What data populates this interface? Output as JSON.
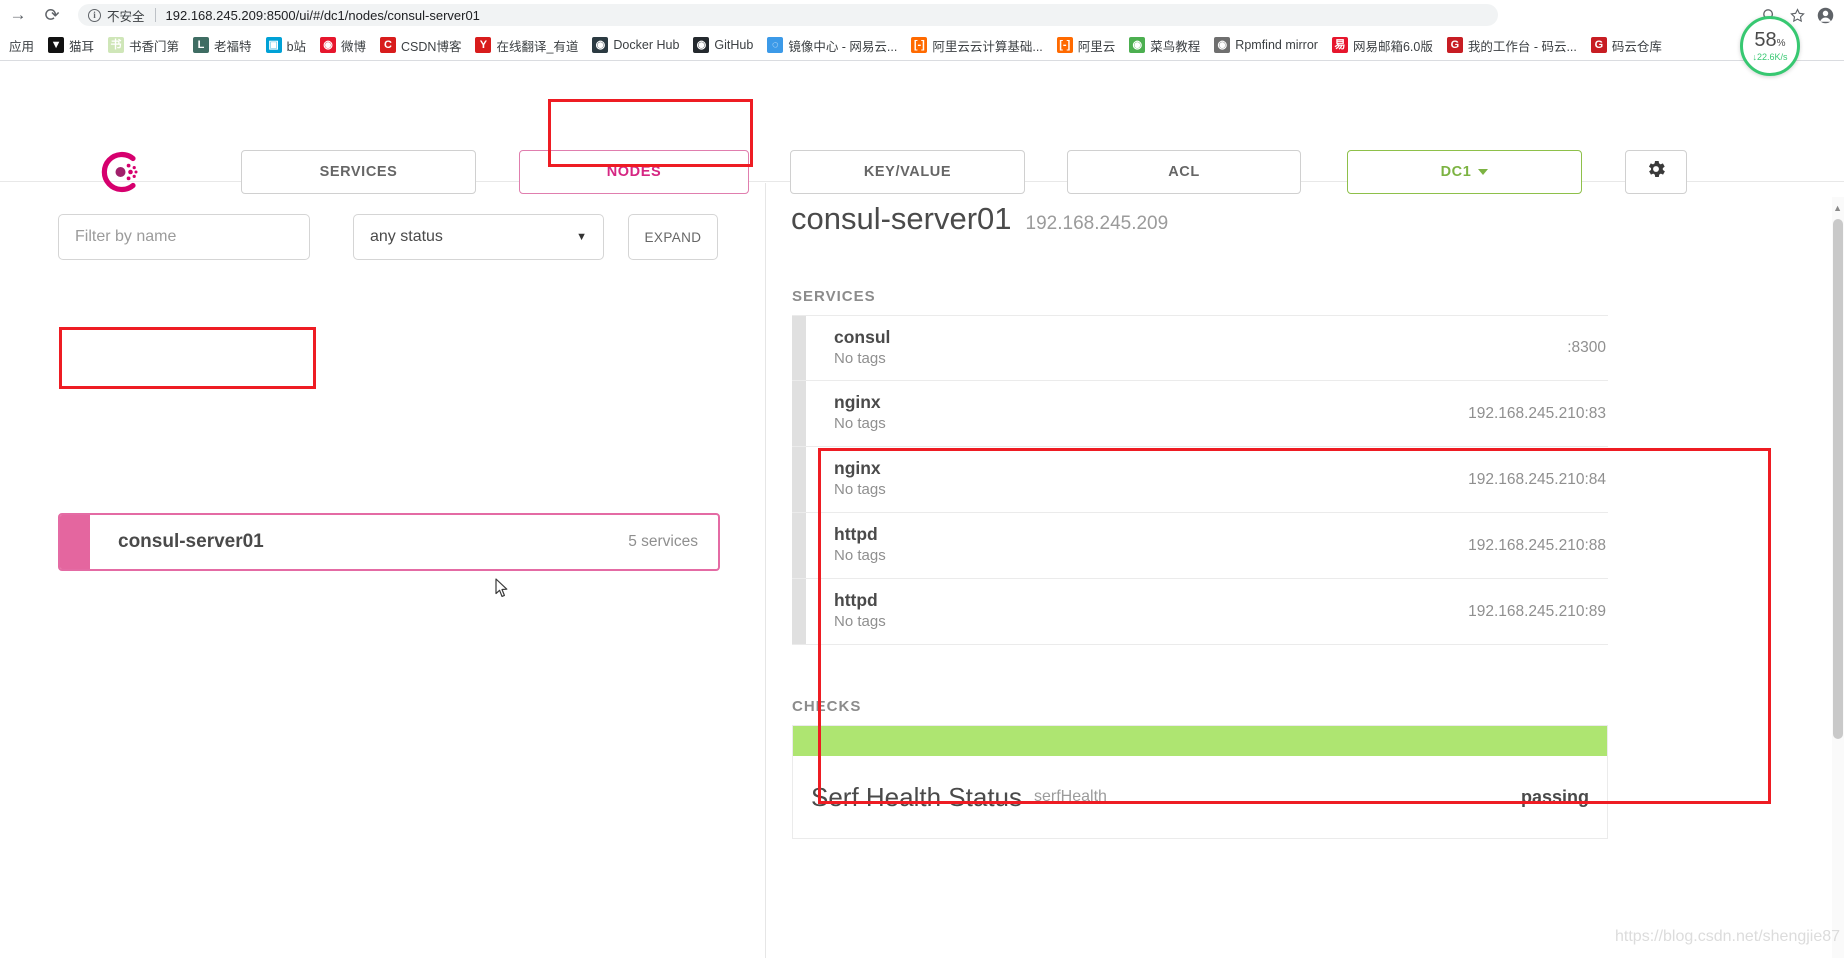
{
  "browser": {
    "nav": {
      "forward": "→",
      "reload": "⟳"
    },
    "omnibox": {
      "security_label": "不安全",
      "url": "192.168.245.209:8500/ui/#/dc1/nodes/consul-server01",
      "info_icon": "info-icon"
    },
    "right_icons": [
      "zoom-icon",
      "star-icon",
      "profile-icon"
    ],
    "bookmarks": [
      {
        "label": "应用",
        "icon": "apps-icon",
        "color": "transparent",
        "glyph": ""
      },
      {
        "label": "猫耳",
        "icon": "maoer-icon",
        "color": "#111111",
        "glyph": "▼"
      },
      {
        "label": "书香门第",
        "icon": "shuxiang-icon",
        "color": "#cfe6b8",
        "glyph": "书"
      },
      {
        "label": "老福特",
        "icon": "lofter-icon",
        "color": "#3f6d63",
        "glyph": "L"
      },
      {
        "label": "b站",
        "icon": "bilibili-icon",
        "color": "#00a1d6",
        "glyph": "▣"
      },
      {
        "label": "微博",
        "icon": "weibo-icon",
        "color": "#e6162d",
        "glyph": "◉"
      },
      {
        "label": "CSDN博客",
        "icon": "csdn-icon",
        "color": "#d81c1c",
        "glyph": "C"
      },
      {
        "label": "在线翻译_有道",
        "icon": "youdao-icon",
        "color": "#d81c1c",
        "glyph": "Y"
      },
      {
        "label": "Docker Hub",
        "icon": "docker-icon",
        "color": "#2b3a42",
        "glyph": "◉"
      },
      {
        "label": "GitHub",
        "icon": "github-icon",
        "color": "#24292e",
        "glyph": "◉"
      },
      {
        "label": "镜像中心 - 网易云...",
        "icon": "netease-cloud-icon",
        "color": "#3c9ae8",
        "glyph": "◌"
      },
      {
        "label": "阿里云云计算基础...",
        "icon": "aliyun-icon",
        "color": "#ff6a00",
        "glyph": "[-]"
      },
      {
        "label": "阿里云",
        "icon": "aliyun-icon",
        "color": "#ff6a00",
        "glyph": "[-]"
      },
      {
        "label": "菜鸟教程",
        "icon": "runoob-icon",
        "color": "#4caf50",
        "glyph": "◉"
      },
      {
        "label": "Rpmfind mirror",
        "icon": "rpmfind-icon",
        "color": "#6f6f6f",
        "glyph": "◉"
      },
      {
        "label": "网易邮箱6.0版",
        "icon": "netease-mail-icon",
        "color": "#e6162d",
        "glyph": "易"
      },
      {
        "label": "我的工作台 - 码云...",
        "icon": "gitee-icon",
        "color": "#c71d23",
        "glyph": "G"
      },
      {
        "label": "码云仓库",
        "icon": "gitee-icon",
        "color": "#c71d23",
        "glyph": "G"
      }
    ],
    "speed_badge": {
      "percent": "58",
      "percent_unit": "%",
      "rate": "↓22.6K/s",
      "color": "#37c871"
    }
  },
  "app": {
    "logo": "consul-logo",
    "nav": [
      {
        "label": "SERVICES",
        "name": "services",
        "active": false
      },
      {
        "label": "NODES",
        "name": "nodes",
        "active": true
      },
      {
        "label": "KEY/VALUE",
        "name": "keyvalue",
        "active": false
      },
      {
        "label": "ACL",
        "name": "acl",
        "active": false
      }
    ],
    "datacenter": {
      "label": "DC1",
      "caret": "▾",
      "color": "#7cb342"
    },
    "settings_icon": "gear-icon",
    "accent_pink": "#d62783",
    "accent_green": "#7cb342",
    "annotation_color": "#ee1c23"
  },
  "left_pane": {
    "filter_placeholder": "Filter by name",
    "filter_value": "",
    "status_select": {
      "value": "any status",
      "arrow": "▼"
    },
    "expand_button": "EXPAND",
    "nodes": [
      {
        "name": "consul-server01",
        "services_count": "5 services"
      }
    ]
  },
  "detail": {
    "node_name": "consul-server01",
    "node_ip": "192.168.245.209",
    "services_heading": "SERVICES",
    "services": [
      {
        "name": "consul",
        "tags": "No tags",
        "address": ":8300",
        "highlighted": false
      },
      {
        "name": "nginx",
        "tags": "No tags",
        "address": "192.168.245.210:83",
        "highlighted": true
      },
      {
        "name": "nginx",
        "tags": "No tags",
        "address": "192.168.245.210:84",
        "highlighted": true
      },
      {
        "name": "httpd",
        "tags": "No tags",
        "address": "192.168.245.210:88",
        "highlighted": true
      },
      {
        "name": "httpd",
        "tags": "No tags",
        "address": "192.168.245.210:89",
        "highlighted": true
      }
    ],
    "checks_heading": "CHECKS",
    "checks": [
      {
        "name": "Serf Health Status",
        "id": "serfHealth",
        "state": "passing",
        "color": "#aee571"
      }
    ]
  },
  "watermark": "https://blog.csdn.net/shengjie87"
}
